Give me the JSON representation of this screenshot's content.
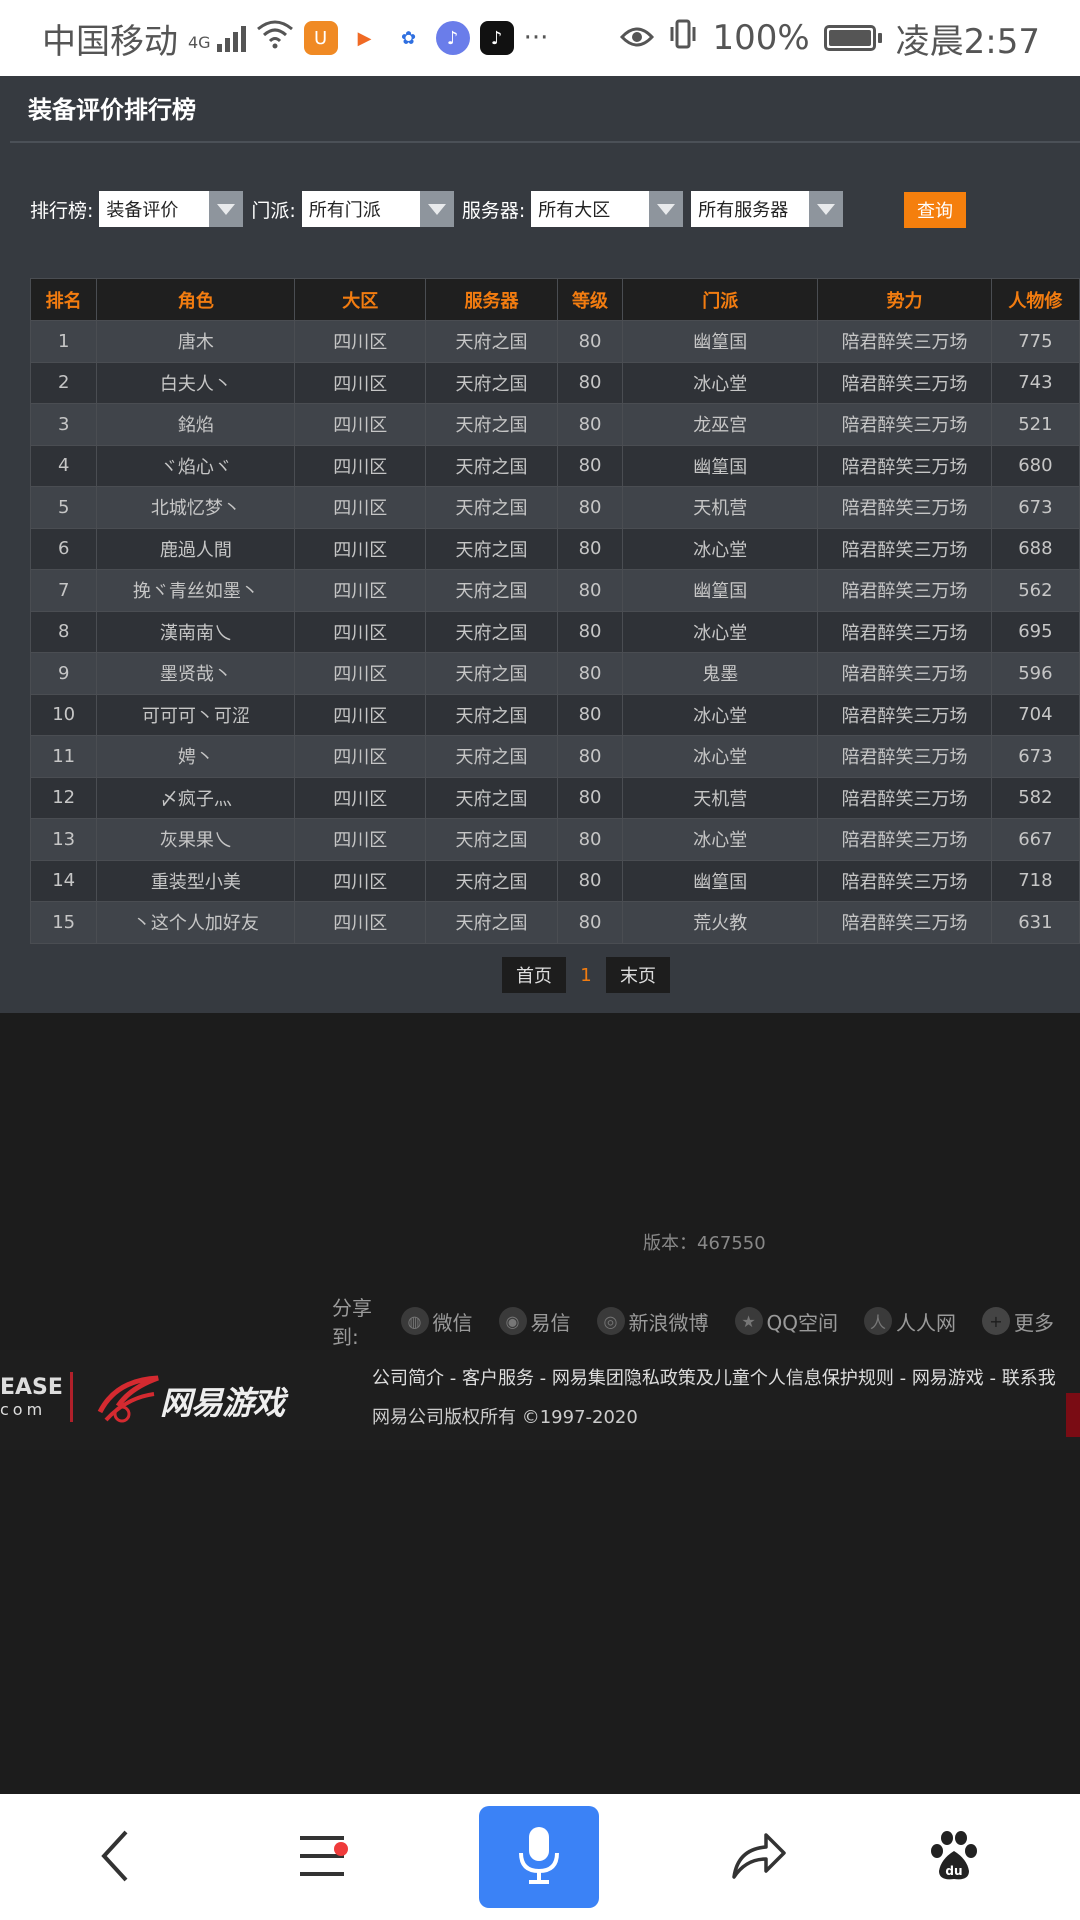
{
  "status_bar": {
    "carrier": "中国移动",
    "signal_label": "4G",
    "more": "···",
    "battery": "100%",
    "time": "凌晨2:57"
  },
  "page": {
    "title": "装备评价排行榜"
  },
  "filters": {
    "rank_label": "排行榜:",
    "rank_value": "装备评价",
    "school_label": "门派:",
    "school_value": "所有门派",
    "server_label": "服务器:",
    "region_value": "所有大区",
    "server_value": "所有服务器",
    "query_button": "查询"
  },
  "table": {
    "columns": [
      "排名",
      "角色",
      "大区",
      "服务器",
      "等级",
      "门派",
      "势力",
      "人物修"
    ],
    "rows": [
      [
        "1",
        "唐木",
        "四川区",
        "天府之国",
        "80",
        "幽篁国",
        "陪君醉笑三万场",
        "775"
      ],
      [
        "2",
        "白夫人丶",
        "四川区",
        "天府之国",
        "80",
        "冰心堂",
        "陪君醉笑三万场",
        "743"
      ],
      [
        "3",
        "銘焰",
        "四川区",
        "天府之国",
        "80",
        "龙巫宫",
        "陪君醉笑三万场",
        "521"
      ],
      [
        "4",
        "ヾ焰心ヾ",
        "四川区",
        "天府之国",
        "80",
        "幽篁国",
        "陪君醉笑三万场",
        "680"
      ],
      [
        "5",
        "北城忆梦丶",
        "四川区",
        "天府之国",
        "80",
        "天机营",
        "陪君醉笑三万场",
        "673"
      ],
      [
        "6",
        "鹿過人間",
        "四川区",
        "天府之国",
        "80",
        "冰心堂",
        "陪君醉笑三万场",
        "688"
      ],
      [
        "7",
        "挽ヾ青丝如墨丶",
        "四川区",
        "天府之国",
        "80",
        "幽篁国",
        "陪君醉笑三万场",
        "562"
      ],
      [
        "8",
        "漢南南乀",
        "四川区",
        "天府之国",
        "80",
        "冰心堂",
        "陪君醉笑三万场",
        "695"
      ],
      [
        "9",
        "墨贤哉丶",
        "四川区",
        "天府之国",
        "80",
        "鬼墨",
        "陪君醉笑三万场",
        "596"
      ],
      [
        "10",
        "可可可丶可涩",
        "四川区",
        "天府之国",
        "80",
        "冰心堂",
        "陪君醉笑三万场",
        "704"
      ],
      [
        "11",
        "娉丶",
        "四川区",
        "天府之国",
        "80",
        "冰心堂",
        "陪君醉笑三万场",
        "673"
      ],
      [
        "12",
        "〆疯子灬",
        "四川区",
        "天府之国",
        "80",
        "天机营",
        "陪君醉笑三万场",
        "582"
      ],
      [
        "13",
        "灰果果乀",
        "四川区",
        "天府之国",
        "80",
        "冰心堂",
        "陪君醉笑三万场",
        "667"
      ],
      [
        "14",
        "重装型小美",
        "四川区",
        "天府之国",
        "80",
        "幽篁国",
        "陪君醉笑三万场",
        "718"
      ],
      [
        "15",
        "丶这个人加好友",
        "四川区",
        "天府之国",
        "80",
        "荒火教",
        "陪君醉笑三万场",
        "631"
      ]
    ]
  },
  "pager": {
    "first": "首页",
    "current": "1",
    "last": "末页"
  },
  "footer": {
    "version": "版本：467550",
    "share_label": "分享到:",
    "share_items": [
      "微信",
      "易信",
      "新浪微博",
      "QQ空间",
      "人人网",
      "更多"
    ],
    "logo_left_top": "EASE",
    "logo_left_bottom": "com",
    "logo_text": "网易游戏",
    "links": "公司简介 - 客户服务 - 网易集团隐私政策及儿童个人信息保护规则 - 网易游戏 - 联系我",
    "copyright": "网易公司版权所有 ©1997-2020"
  },
  "colors": {
    "accent": "#f27c10",
    "query_button": "#f57f0d",
    "mic_button": "#3b82f6",
    "page_bg": "#363a40"
  },
  "bottom_nav": [
    "back-icon",
    "menu-icon",
    "mic-icon",
    "share-icon",
    "baidu-paw-icon"
  ]
}
